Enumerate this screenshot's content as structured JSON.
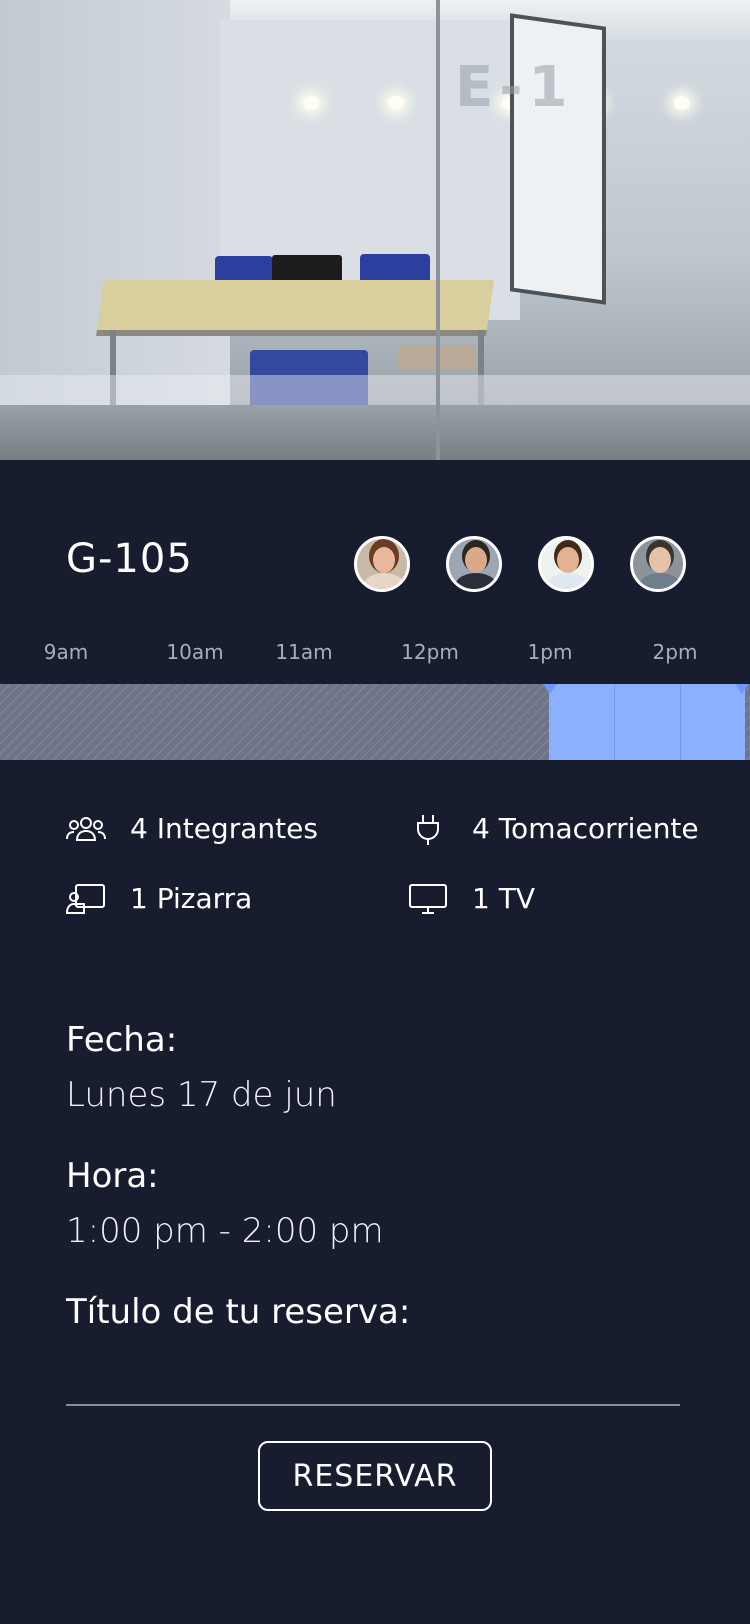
{
  "room": {
    "title": "G-105",
    "photo_alt": "room-photo"
  },
  "participants": [
    {
      "name": "avatar-1",
      "skin": "#e7b99a",
      "hair": "#6b3b22",
      "shirt": "#e5d6c8"
    },
    {
      "name": "avatar-2",
      "skin": "#d9a98a",
      "hair": "#2e241e",
      "shirt": "#2a2f3a"
    },
    {
      "name": "avatar-3",
      "skin": "#e2b293",
      "hair": "#3d2a1f",
      "shirt": "#dfe8f0"
    },
    {
      "name": "avatar-4",
      "skin": "#e6c2a7",
      "hair": "#3a342f",
      "shirt": "#6d7e8c"
    }
  ],
  "timeline": {
    "labels": [
      "9am",
      "10am",
      "11am",
      "12pm",
      "1pm",
      "2pm"
    ],
    "selected": "1:00 pm - 2:00 pm",
    "slot_color": "#8bb0ff"
  },
  "amenities": {
    "members": "4 Integrantes",
    "outlets": "4 Tomacorriente",
    "whiteboard": "1 Pizarra",
    "tv": "1 TV"
  },
  "booking": {
    "date_label": "Fecha:",
    "date_value": "Lunes 17 de jun",
    "time_label": "Hora:",
    "time_value": "1:00 pm - 2:00 pm",
    "title_label": "Título de tu reserva:",
    "title_value": ""
  },
  "actions": {
    "reserve": "RESERVAR"
  },
  "colors": {
    "background": "#181c2f",
    "accent": "#8bb0ff",
    "busy": "#6f7589"
  }
}
